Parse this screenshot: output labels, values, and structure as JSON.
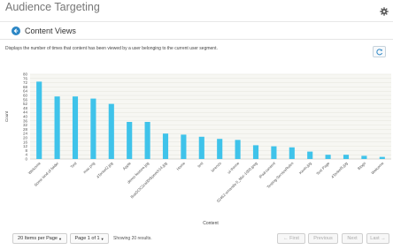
{
  "app": {
    "title": "Audience Targeting"
  },
  "section": {
    "title": "Content Views"
  },
  "description": "Displays the number of times that content has been viewed by a user belonging to the current user segment.",
  "pagination": {
    "items_per_page": "20 Items per Page",
    "page": "Page 1 of 1",
    "results": "Showing 20 results.",
    "first": "← First",
    "previous": "Previous",
    "next": "Next",
    "last": "Last →"
  },
  "colors": {
    "bar": "#3fc3ea",
    "accent": "#2b86c5",
    "plot_bg": "#f7f7f3",
    "grid": "#e4e4dc"
  },
  "chart_data": {
    "type": "bar",
    "title": "",
    "xlabel": "Content",
    "ylabel": "Count",
    "ylim": [
      0,
      80
    ],
    "yticks": [
      0,
      4,
      8,
      12,
      16,
      20,
      24,
      28,
      32,
      36,
      40,
      44,
      48,
      52,
      56,
      60,
      64,
      68,
      72,
      76,
      80
    ],
    "grid": true,
    "categories": [
      "Welcome",
      "Some kind of folder",
      "Test",
      "mac.png",
      "4Tonkel2.jpg",
      "Apple",
      "demo-feature.jpg",
      "BusDOC2ca00tSpeech14.jpg",
      "Home",
      "test",
      "lorenzo",
      "ui-theme",
      "02462-amanda-5_Mar-1000.jpeg",
      "iPad-content",
      "Testing-ServiceRules",
      "Kevin.jpg",
      "Test Page",
      "4Tonkel5.jpg",
      "Blogs",
      "Welcome"
    ],
    "values": [
      73,
      59,
      59,
      57,
      52,
      35,
      35,
      24,
      23,
      21,
      19,
      18,
      13,
      12,
      11,
      7,
      4,
      4,
      3,
      2
    ]
  }
}
